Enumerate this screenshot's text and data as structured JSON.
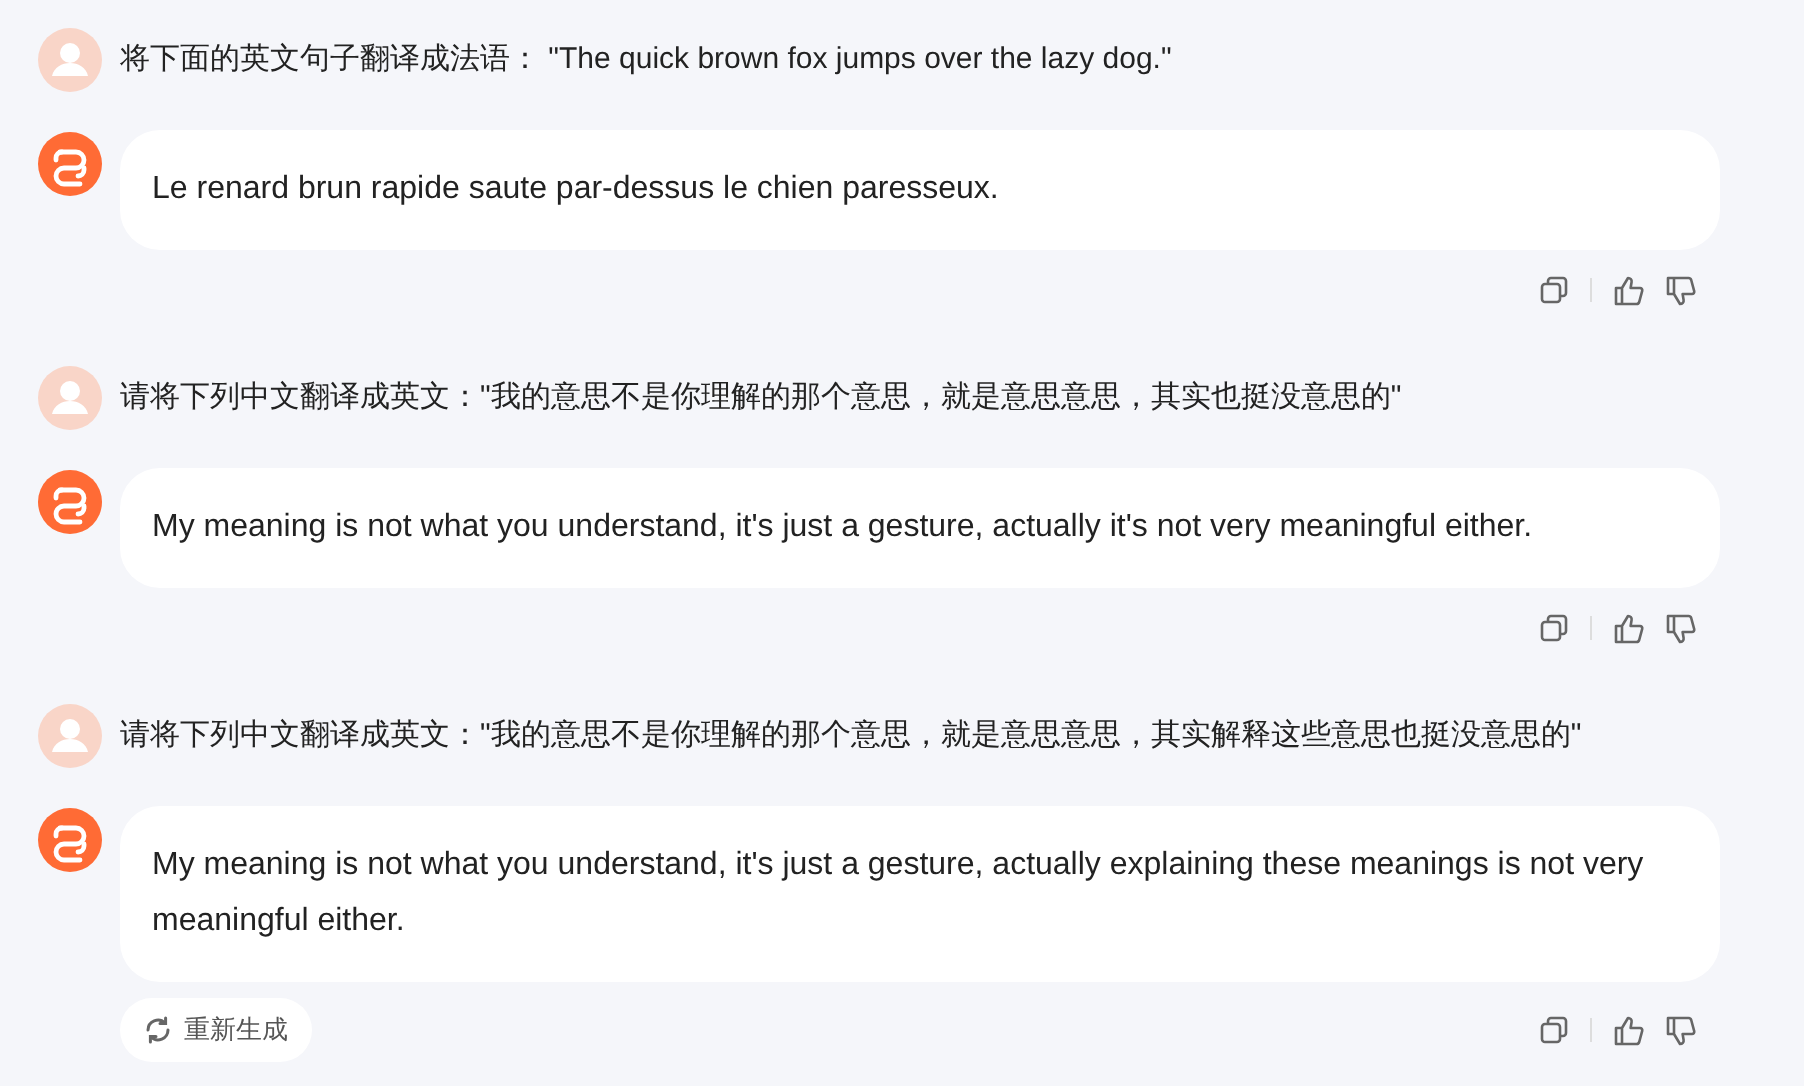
{
  "exchanges": [
    {
      "prompt": "将下面的英文句子翻译成法语： \"The quick brown fox jumps over the lazy dog.\"",
      "reply": "Le renard brun rapide saute par-dessus le chien paresseux."
    },
    {
      "prompt": "请将下列中文翻译成英文：\"我的意思不是你理解的那个意思，就是意思意思，其实也挺没意思的\"",
      "reply": "My meaning is not what you understand, it's just a gesture, actually it's not very meaningful either."
    },
    {
      "prompt": "请将下列中文翻译成英文：\"我的意思不是你理解的那个意思，就是意思意思，其实解释这些意思也挺没意思的\"",
      "reply": "My meaning is not what you understand, it's just a gesture, actually explaining these meanings is not very meaningful either.",
      "regenerate_label": "重新生成"
    }
  ]
}
